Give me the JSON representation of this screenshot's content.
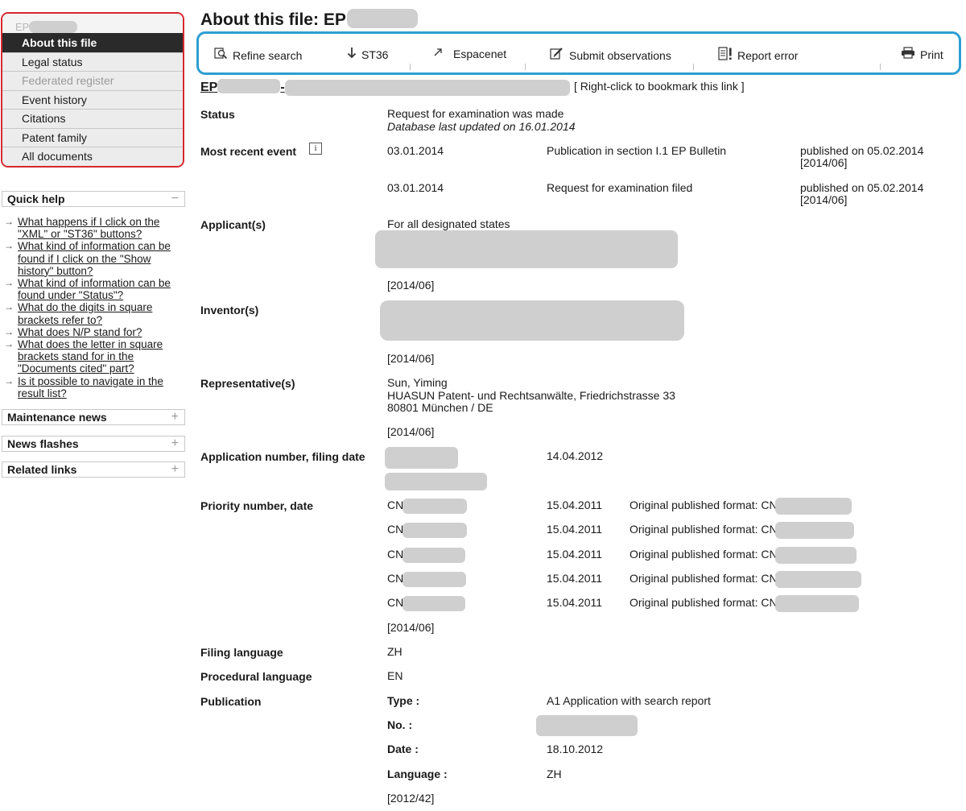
{
  "nav": {
    "header": "EP",
    "items": [
      {
        "label": "About this file",
        "state": "active"
      },
      {
        "label": "Legal status",
        "state": "normal"
      },
      {
        "label": "Federated register",
        "state": "disabled"
      },
      {
        "label": "Event history",
        "state": "normal"
      },
      {
        "label": "Citations",
        "state": "normal"
      },
      {
        "label": "Patent family",
        "state": "normal"
      },
      {
        "label": "All documents",
        "state": "normal"
      }
    ]
  },
  "quick_help": {
    "title": "Quick help",
    "toggle": "−",
    "links": [
      [
        "What happens if I click on the",
        "\"XML\" or \"ST36\" buttons?"
      ],
      [
        "What kind of information can be",
        "found if I click on the \"Show",
        "history\" button?"
      ],
      [
        "What kind of information can be",
        "found under \"Status\"?"
      ],
      [
        "What do the digits in square",
        "brackets refer to?"
      ],
      [
        "What does N/P stand for?"
      ],
      [
        "What does the letter in square",
        "brackets stand for in the",
        "\"Documents cited\" part?"
      ],
      [
        "Is it possible to navigate in the",
        "result list?"
      ]
    ]
  },
  "panels": [
    {
      "title": "Maintenance news",
      "toggle": "+"
    },
    {
      "title": "News flashes",
      "toggle": "+"
    },
    {
      "title": "Related links",
      "toggle": "+"
    }
  ],
  "page": {
    "title": "About this file: EP",
    "ep_link": "EP",
    "ep_dash": "-",
    "bookmark": "[ Right-click to bookmark this link ]"
  },
  "toolbar": {
    "refine_search": "Refine search",
    "st36": "ST36",
    "espacenet": "Espacenet",
    "submit_observations": "Submit observations",
    "report_error": "Report error",
    "print": "Print",
    "icons": [
      "magnifier-icon",
      "download-arrow-icon",
      "external-link-icon",
      "edit-icon",
      "report-icon",
      "printer-icon"
    ]
  },
  "fields": {
    "status": {
      "label": "Status",
      "value": "Request for examination was made",
      "updated": "Database last updated on   16.01.2014"
    },
    "recent_event": {
      "label": "Most recent event",
      "events": [
        {
          "date": "03.01.2014",
          "text": "Publication in section I.1 EP Bulletin",
          "published": "published on 05.02.2014",
          "bulletin": "[2014/06]"
        },
        {
          "date": "03.01.2014",
          "text": "Request for examination filed",
          "published": "published on 05.02.2014",
          "bulletin": "[2014/06]"
        }
      ]
    },
    "applicant": {
      "label": "Applicant(s)",
      "value": "For all designated states",
      "bulletin": "[2014/06]"
    },
    "inventor": {
      "label": "Inventor(s)",
      "bulletin": "[2014/06]"
    },
    "representative": {
      "label": "Representative(s)",
      "lines": [
        "Sun, Yiming",
        "HUASUN Patent- und Rechtsanwälte, Friedrichstrasse 33",
        "80801 München / DE"
      ],
      "bulletin": "[2014/06]"
    },
    "application": {
      "label": "Application number, filing date",
      "date": "14.04.2012"
    },
    "priority": {
      "label": "Priority number, date",
      "rows": [
        {
          "number": "CN",
          "date": "15.04.2011",
          "format": "Original published format: CN"
        },
        {
          "number": "CN",
          "date": "15.04.2011",
          "format": "Original published format: CN"
        },
        {
          "number": "CN",
          "date": "15.04.2011",
          "format": "Original published format: CN"
        },
        {
          "number": "CN",
          "date": "15.04.2011",
          "format": "Original published format: CN"
        },
        {
          "number": "CN",
          "date": "15.04.2011",
          "format": "Original published format: CN"
        }
      ],
      "bulletin": "[2014/06]"
    },
    "filing_language": {
      "label": "Filing language",
      "value": "ZH"
    },
    "procedural_language": {
      "label": "Procedural language",
      "value": "EN"
    },
    "publication": {
      "label": "Publication",
      "type_label": "Type :",
      "type_value": "A1   Application with search report",
      "no_label": "No. :",
      "date_label": "Date :",
      "date_value": "18.10.2012",
      "language_label": "Language :",
      "language_value": "ZH",
      "bulletin": "[2012/42]"
    }
  },
  "colors": {
    "nav_outline": "#d7282f",
    "toolbar_outline": "#2e9fd1",
    "nav_active": "#2a2a2a"
  }
}
